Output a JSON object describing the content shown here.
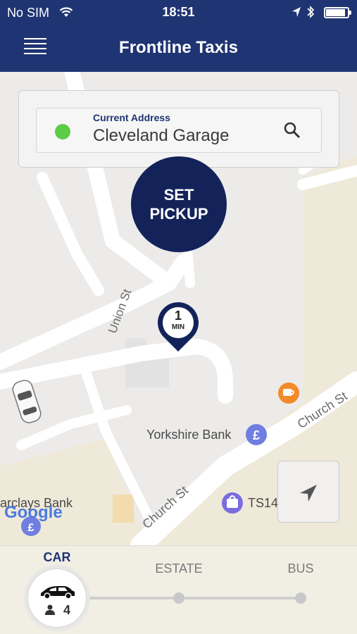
{
  "status_bar": {
    "carrier": "No SIM",
    "time": "18:51",
    "wifi_icon": "wifi-icon",
    "location_icon": "location-arrow-icon",
    "bluetooth_icon": "bluetooth-icon",
    "battery_level": 0.9
  },
  "nav": {
    "title": "Frontline Taxis",
    "menu_icon": "hamburger-menu-icon"
  },
  "address": {
    "label": "Current Address",
    "value": "Cleveland Garage",
    "status_color": "#5ccb47",
    "search_icon": "search-icon"
  },
  "pickup_button": {
    "line1": "SET",
    "line2": "PICKUP"
  },
  "eta_pin": {
    "value": "1",
    "unit": "MIN"
  },
  "map": {
    "labels": {
      "union_st": "Union St",
      "yorkshire_bank": "Yorkshire Bank",
      "church_st_lower": "Church St",
      "church_st_upper": "Church St",
      "barclays_bank": "arclays Bank",
      "ts14": "TS14",
      "google": "Google"
    },
    "poi_icons": [
      "bank-icon",
      "cafe-icon",
      "shopping-icon",
      "taxi-car-icon"
    ]
  },
  "vehicles": {
    "selected": "CAR",
    "options": [
      {
        "label": "CAR"
      },
      {
        "label": "ESTATE"
      },
      {
        "label": "BUS"
      }
    ],
    "passenger_count": "4"
  },
  "colors": {
    "brand": "#1f3473",
    "pickup": "#13235a"
  }
}
